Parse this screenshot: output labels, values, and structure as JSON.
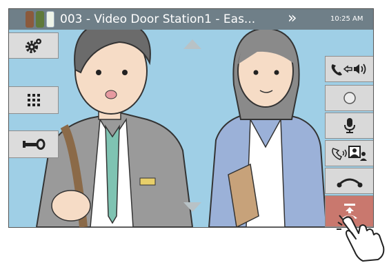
{
  "status": {
    "title": "003 - Video Door Station1 - Eas...",
    "next_icon": "double-chevron-right-icon",
    "time": "10:25 AM"
  },
  "left_buttons": [
    {
      "icon": "settings-gear-icon"
    },
    {
      "icon": "keypad-icon"
    },
    {
      "icon": "door-key-icon"
    }
  ],
  "right_buttons": [
    {
      "icon": "handset-to-speaker-icon"
    },
    {
      "icon": "record-icon"
    },
    {
      "icon": "microphone-icon"
    },
    {
      "icon": "transfer-call-icon"
    },
    {
      "icon": "hang-up-icon"
    },
    {
      "icon": "end-call-icon"
    }
  ],
  "colors": {
    "status_bar": "#6f7f88",
    "video_background": "#9fcfe6",
    "button": "#d9d9d9",
    "end_call_button": "#c9786e"
  }
}
